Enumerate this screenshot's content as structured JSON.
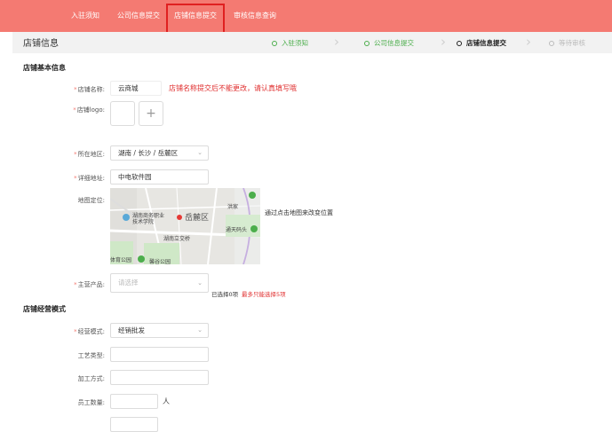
{
  "nav": {
    "items": [
      "入驻须知",
      "公司信息提交",
      "店铺信息提交",
      "审核信息查询"
    ]
  },
  "header": {
    "title": "店铺信息"
  },
  "steps": [
    {
      "label": "入驻须知",
      "state": "done"
    },
    {
      "label": "公司信息提交",
      "state": "done"
    },
    {
      "label": "店铺信息提交",
      "state": "current"
    },
    {
      "label": "等待审核",
      "state": "pending"
    }
  ],
  "basic_section": {
    "title": "店铺基本信息"
  },
  "form": {
    "store_name": {
      "label": "店铺名称:",
      "value": "云商城",
      "warning": "店铺名称提交后不能更改，请认真填写哦"
    },
    "store_logo": {
      "label": "店铺logo:",
      "plus": "+"
    },
    "region": {
      "label": "所在地区:",
      "value": "湖南 / 长沙 / 岳麓区"
    },
    "address": {
      "label": "详细地址:",
      "value": "中电软件园"
    },
    "map": {
      "label": "地图定位:",
      "hint": "通过点击地图来改变位置",
      "places": [
        "湖南商务职业技术学院",
        "岳麓区",
        "湖南立交桥",
        "体育公园",
        "馨谷公园",
        "洪家",
        "通天码头"
      ]
    },
    "products": {
      "label": "主营产品:",
      "placeholder": "请选择",
      "selected_text": "已选择0项",
      "max_text": "最多只能选择5项"
    }
  },
  "business_section": {
    "title": "店铺经营模式"
  },
  "business": {
    "mode": {
      "label": "经营模式:",
      "value": "经销批发"
    },
    "craft": {
      "label": "工艺类型:",
      "value": ""
    },
    "process": {
      "label": "加工方式:",
      "value": ""
    },
    "staff": {
      "label": "员工数量:",
      "value": "",
      "unit": "人"
    }
  },
  "colors": {
    "accent": "#f47a72",
    "done": "#4cae4c",
    "warning": "#e03030"
  }
}
